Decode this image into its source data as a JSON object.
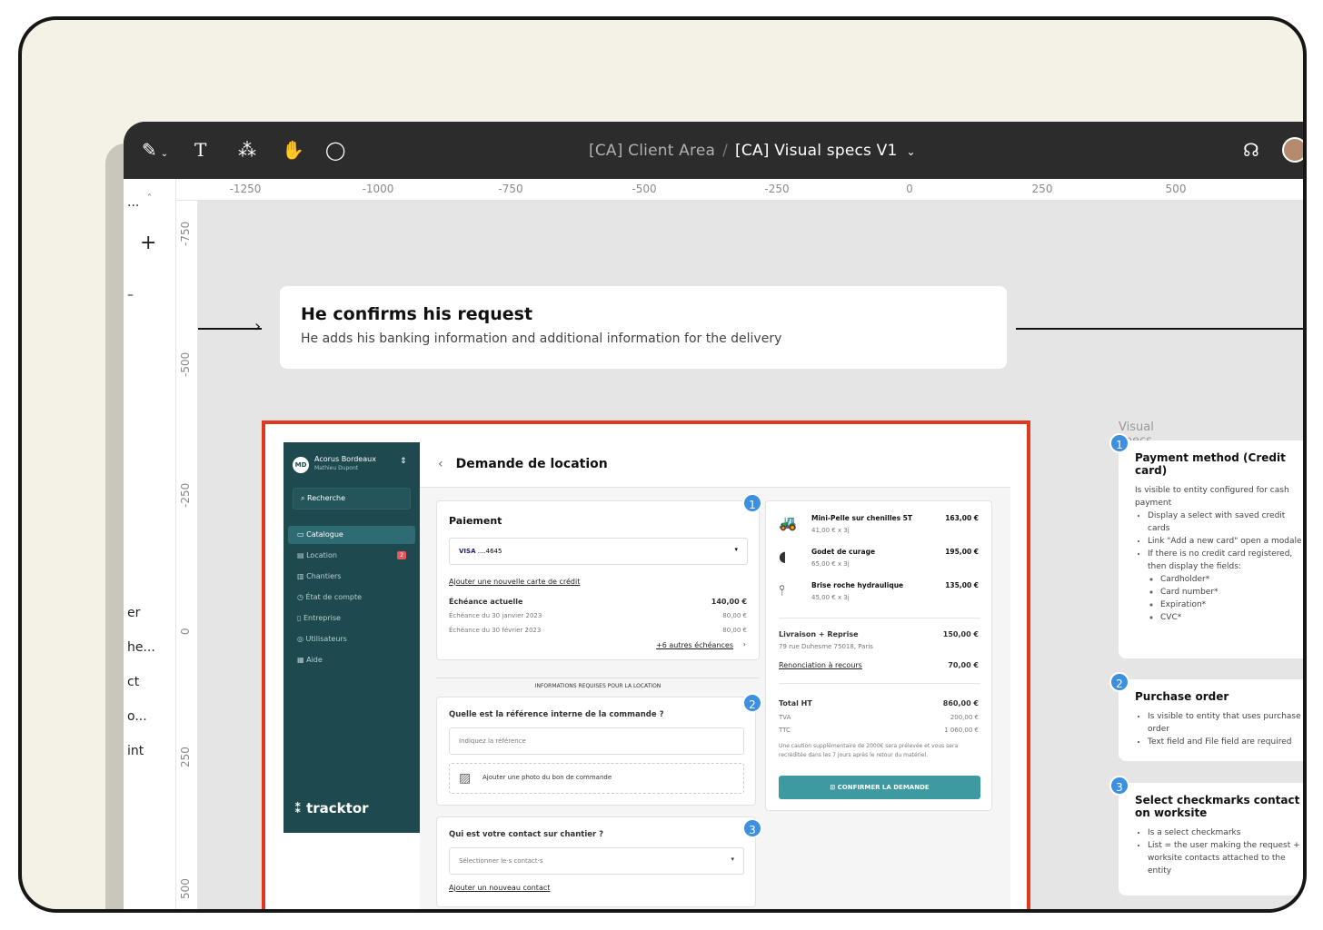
{
  "toolbar": {
    "breadcrumb_parent": "[CA] Client Area",
    "breadcrumb_current": "[CA] Visual specs V1"
  },
  "ruler_h": [
    "-1250",
    "-1000",
    "-750",
    "-500",
    "-250",
    "0",
    "250",
    "500"
  ],
  "ruler_v": [
    "-750",
    "-500",
    "-250",
    "0",
    "250",
    "500"
  ],
  "left_panel": [
    "...",
    "er",
    "he...",
    "ct",
    "o...",
    "int"
  ],
  "step": {
    "title": "He confirms his request",
    "subtitle": "He adds his banking information and additional information for the delivery"
  },
  "app": {
    "company": "Acorus Bordeaux",
    "user": "Mathieu Dupont",
    "avatar": "MD",
    "search": "Recherche",
    "nav": [
      {
        "label": "Catalogue"
      },
      {
        "label": "Location",
        "badge": "2"
      },
      {
        "label": "Chantiers"
      },
      {
        "label": "État de compte"
      },
      {
        "label": "Entreprise"
      },
      {
        "label": "Utilisateurs"
      },
      {
        "label": "Aide"
      }
    ],
    "logo": "tracktor",
    "page_title": "Demande de location",
    "payment": {
      "title": "Paiement",
      "card": "....4645",
      "add_card": "Ajouter une nouvelle carte de crédit",
      "current": "Échéance actuelle",
      "current_amount": "140,00 €",
      "rows": [
        [
          "Échéance du 30 janvier 2023",
          "80,00 €"
        ],
        [
          "Échéance du 30 février 2023",
          "80,00 €"
        ]
      ],
      "more": "+6 autres échéances"
    },
    "divider": "INFORMATIONS REQUISES POUR LA LOCATION",
    "reference": {
      "question": "Quelle est la référence interne de la commande ?",
      "placeholder": "Indiquez la référence",
      "upload_bold": "Ajouter",
      "upload_rest": " une photo du bon de commande"
    },
    "contact": {
      "question": "Qui est votre contact sur chantier ?",
      "placeholder": "Sélectionner le·s contact·s",
      "add": "Ajouter un nouveau contact"
    },
    "items": [
      {
        "name": "Mini-Pelle sur chenilles 5T",
        "sub": "41,00 € x 3j",
        "price": "163,00 €"
      },
      {
        "name": "Godet de curage",
        "sub": "65,00 € x 3j",
        "price": "195,00 €"
      },
      {
        "name": "Brise roche hydraulique",
        "sub": "45,00 € x 3j",
        "price": "135,00 €"
      }
    ],
    "delivery": {
      "label": "Livraison + Reprise",
      "address": "79 rue Duhesme 75018, Paris",
      "price": "150,00 €"
    },
    "renunciation": {
      "label": "Renonciation à recours",
      "price": "70,00 €"
    },
    "totals": {
      "ht_label": "Total HT",
      "ht": "860,00 €",
      "tva_label": "TVA",
      "tva": "200,00 €",
      "ttc_label": "TTC",
      "ttc": "1 060,00 €",
      "note": "Une caution supplémentaire de 2000€ sera prélevée et vous sera recréditée dans les 7 jours après le retour du matériel."
    },
    "confirm": "CONFIRMER LA DEMANDE"
  },
  "specs": {
    "header": "Visual specs",
    "s1": {
      "num": "1",
      "title": "Payment method (Credit card)",
      "intro": "Is visible to entity configured for cash payment",
      "b1": "Display a select with saved credit cards",
      "b2": "Link \"Add a new card\" open a modale",
      "b3": "If there is no credit card registered, then display the fields:",
      "f1": "Cardholder*",
      "f2": "Card number*",
      "f3": "Expiration*",
      "f4": "CVC*"
    },
    "s2": {
      "num": "2",
      "title": "Purchase order",
      "b1": "Is visible to entity that uses purchase order",
      "b2": "Text field and File field are required"
    },
    "s3": {
      "num": "3",
      "title": "Select checkmarks contact on worksite",
      "b1": "Is a select checkmarks",
      "b2": "List = the user making the request + worksite contacts attached to the entity"
    }
  },
  "colors": {
    "accent": "#e0371f",
    "sidebar": "#1e4a4f",
    "badge": "#3d8fe0",
    "button": "#3d9aa0"
  }
}
